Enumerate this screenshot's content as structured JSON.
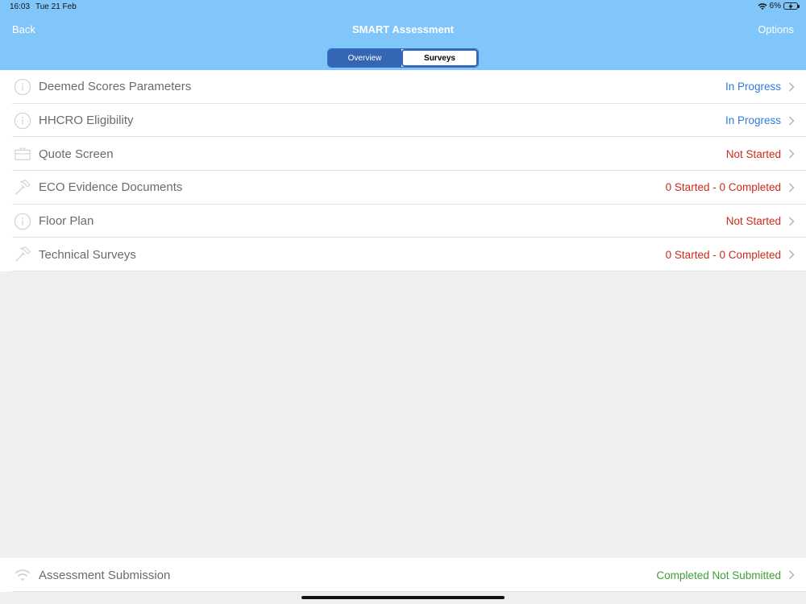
{
  "status_bar": {
    "time": "16:03",
    "date": "Tue 21 Feb",
    "battery_percent": "6%"
  },
  "nav": {
    "back_label": "Back",
    "title": "SMART Assessment",
    "options_label": "Options"
  },
  "segments": {
    "overview": "Overview",
    "surveys": "Surveys",
    "selected": "Surveys"
  },
  "rows": [
    {
      "label": "Deemed Scores Parameters",
      "status": "In Progress",
      "icon": "info-icon",
      "status_color": "#2d7be0"
    },
    {
      "label": "HHCRO Eligibility",
      "status": "In Progress",
      "icon": "info-icon",
      "status_color": "#2d7be0"
    },
    {
      "label": "Quote Screen",
      "status": "Not Started",
      "icon": "briefcase-icon",
      "status_color": "#cc2a1c"
    },
    {
      "label": "ECO Evidence Documents",
      "status": "0 Started - 0 Completed",
      "icon": "hammer-icon",
      "status_color": "#cc2a1c"
    },
    {
      "label": "Floor Plan",
      "status": "Not Started",
      "icon": "info-icon",
      "status_color": "#cc2a1c"
    },
    {
      "label": "Technical Surveys",
      "status": "0 Started - 0 Completed",
      "icon": "hammer-icon",
      "status_color": "#cc2a1c"
    }
  ],
  "submission": {
    "label": "Assessment Submission",
    "status": "Completed Not Submitted",
    "icon": "wifi-icon",
    "status_color": "#3f9e3a"
  },
  "colors": {
    "header_bg": "#80c6fa",
    "segment_accent": "#3566b3",
    "background": "#efeff0"
  }
}
